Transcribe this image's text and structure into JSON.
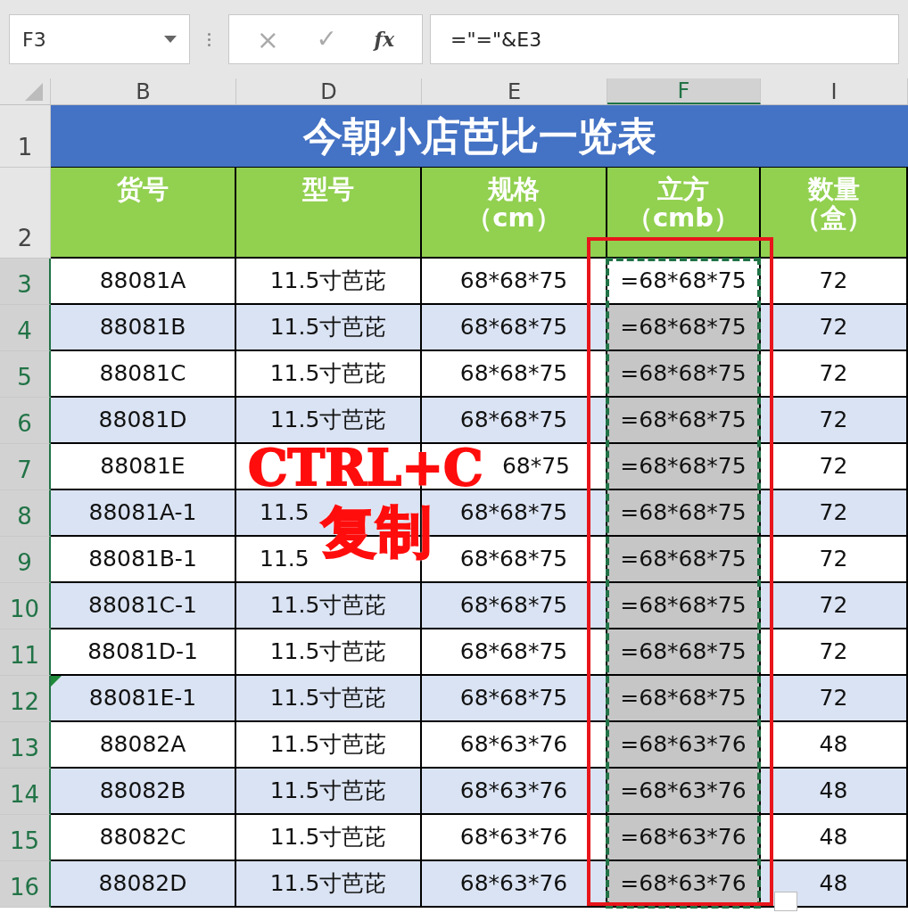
{
  "name_box": "F3",
  "formula_bar": {
    "cancel": "×",
    "enter": "✓",
    "fx": "fx",
    "value": "=\"=\"&E3"
  },
  "columns": [
    {
      "label": "B",
      "selected": false
    },
    {
      "label": "D",
      "selected": false
    },
    {
      "label": "E",
      "selected": false
    },
    {
      "label": "F",
      "selected": true
    },
    {
      "label": "I",
      "selected": false
    }
  ],
  "title_row": {
    "number": "1",
    "title": "今朝小店芭比一览表"
  },
  "header_row": {
    "number": "2",
    "headers": [
      [
        "货号"
      ],
      [
        "型号"
      ],
      [
        "规格",
        "（cm）"
      ],
      [
        "立方",
        "（cmb）"
      ],
      [
        "数量",
        "（盒）"
      ]
    ]
  },
  "rows": [
    {
      "number": "3",
      "cells": [
        "88081A",
        "11.5寸芭芘",
        "68*68*75",
        "=68*68*75",
        "72"
      ],
      "selected": true,
      "active": true,
      "error_indicator": false
    },
    {
      "number": "4",
      "cells": [
        "88081B",
        "11.5寸芭芘",
        "68*68*75",
        "=68*68*75",
        "72"
      ],
      "selected": true,
      "active": false,
      "error_indicator": false
    },
    {
      "number": "5",
      "cells": [
        "88081C",
        "11.5寸芭芘",
        "68*68*75",
        "=68*68*75",
        "72"
      ],
      "selected": true,
      "active": false,
      "error_indicator": false
    },
    {
      "number": "6",
      "cells": [
        "88081D",
        "11.5寸芭芘",
        "68*68*75",
        "=68*68*75",
        "72"
      ],
      "selected": true,
      "active": false,
      "error_indicator": false
    },
    {
      "number": "7",
      "cells": [
        "88081E",
        {
          "kind": "covered"
        },
        {
          "kind": "tail",
          "text": "68*75"
        },
        "=68*68*75",
        "72"
      ],
      "selected": true,
      "active": false,
      "error_indicator": false
    },
    {
      "number": "8",
      "cells": [
        "88081A-1",
        {
          "kind": "head",
          "text": "11.5"
        },
        "68*68*75",
        "=68*68*75",
        "72"
      ],
      "selected": true,
      "active": false,
      "error_indicator": false
    },
    {
      "number": "9",
      "cells": [
        "88081B-1",
        {
          "kind": "head",
          "text": "11.5"
        },
        "68*68*75",
        "=68*68*75",
        "72"
      ],
      "selected": true,
      "active": false,
      "error_indicator": false
    },
    {
      "number": "10",
      "cells": [
        "88081C-1",
        "11.5寸芭芘",
        "68*68*75",
        "=68*68*75",
        "72"
      ],
      "selected": true,
      "active": false,
      "error_indicator": false
    },
    {
      "number": "11",
      "cells": [
        "88081D-1",
        "11.5寸芭芘",
        "68*68*75",
        "=68*68*75",
        "72"
      ],
      "selected": true,
      "active": false,
      "error_indicator": false
    },
    {
      "number": "12",
      "cells": [
        "88081E-1",
        "11.5寸芭芘",
        "68*68*75",
        "=68*68*75",
        "72"
      ],
      "selected": true,
      "active": false,
      "error_indicator": true
    },
    {
      "number": "13",
      "cells": [
        "88082A",
        "11.5寸芭芘",
        "68*63*76",
        "=68*63*76",
        "48"
      ],
      "selected": true,
      "active": false,
      "error_indicator": false
    },
    {
      "number": "14",
      "cells": [
        "88082B",
        "11.5寸芭芘",
        "68*63*76",
        "=68*63*76",
        "48"
      ],
      "selected": true,
      "active": false,
      "error_indicator": false
    },
    {
      "number": "15",
      "cells": [
        "88082C",
        "11.5寸芭芘",
        "68*63*76",
        "=68*63*76",
        "48"
      ],
      "selected": true,
      "active": false,
      "error_indicator": false
    },
    {
      "number": "16",
      "cells": [
        "88082D",
        "11.5寸芭芘",
        "68*63*76",
        "=68*63*76",
        "48"
      ],
      "selected": true,
      "active": false,
      "error_indicator": false
    }
  ],
  "annotation": {
    "lines": [
      "CTRL+C",
      "复制"
    ]
  }
}
